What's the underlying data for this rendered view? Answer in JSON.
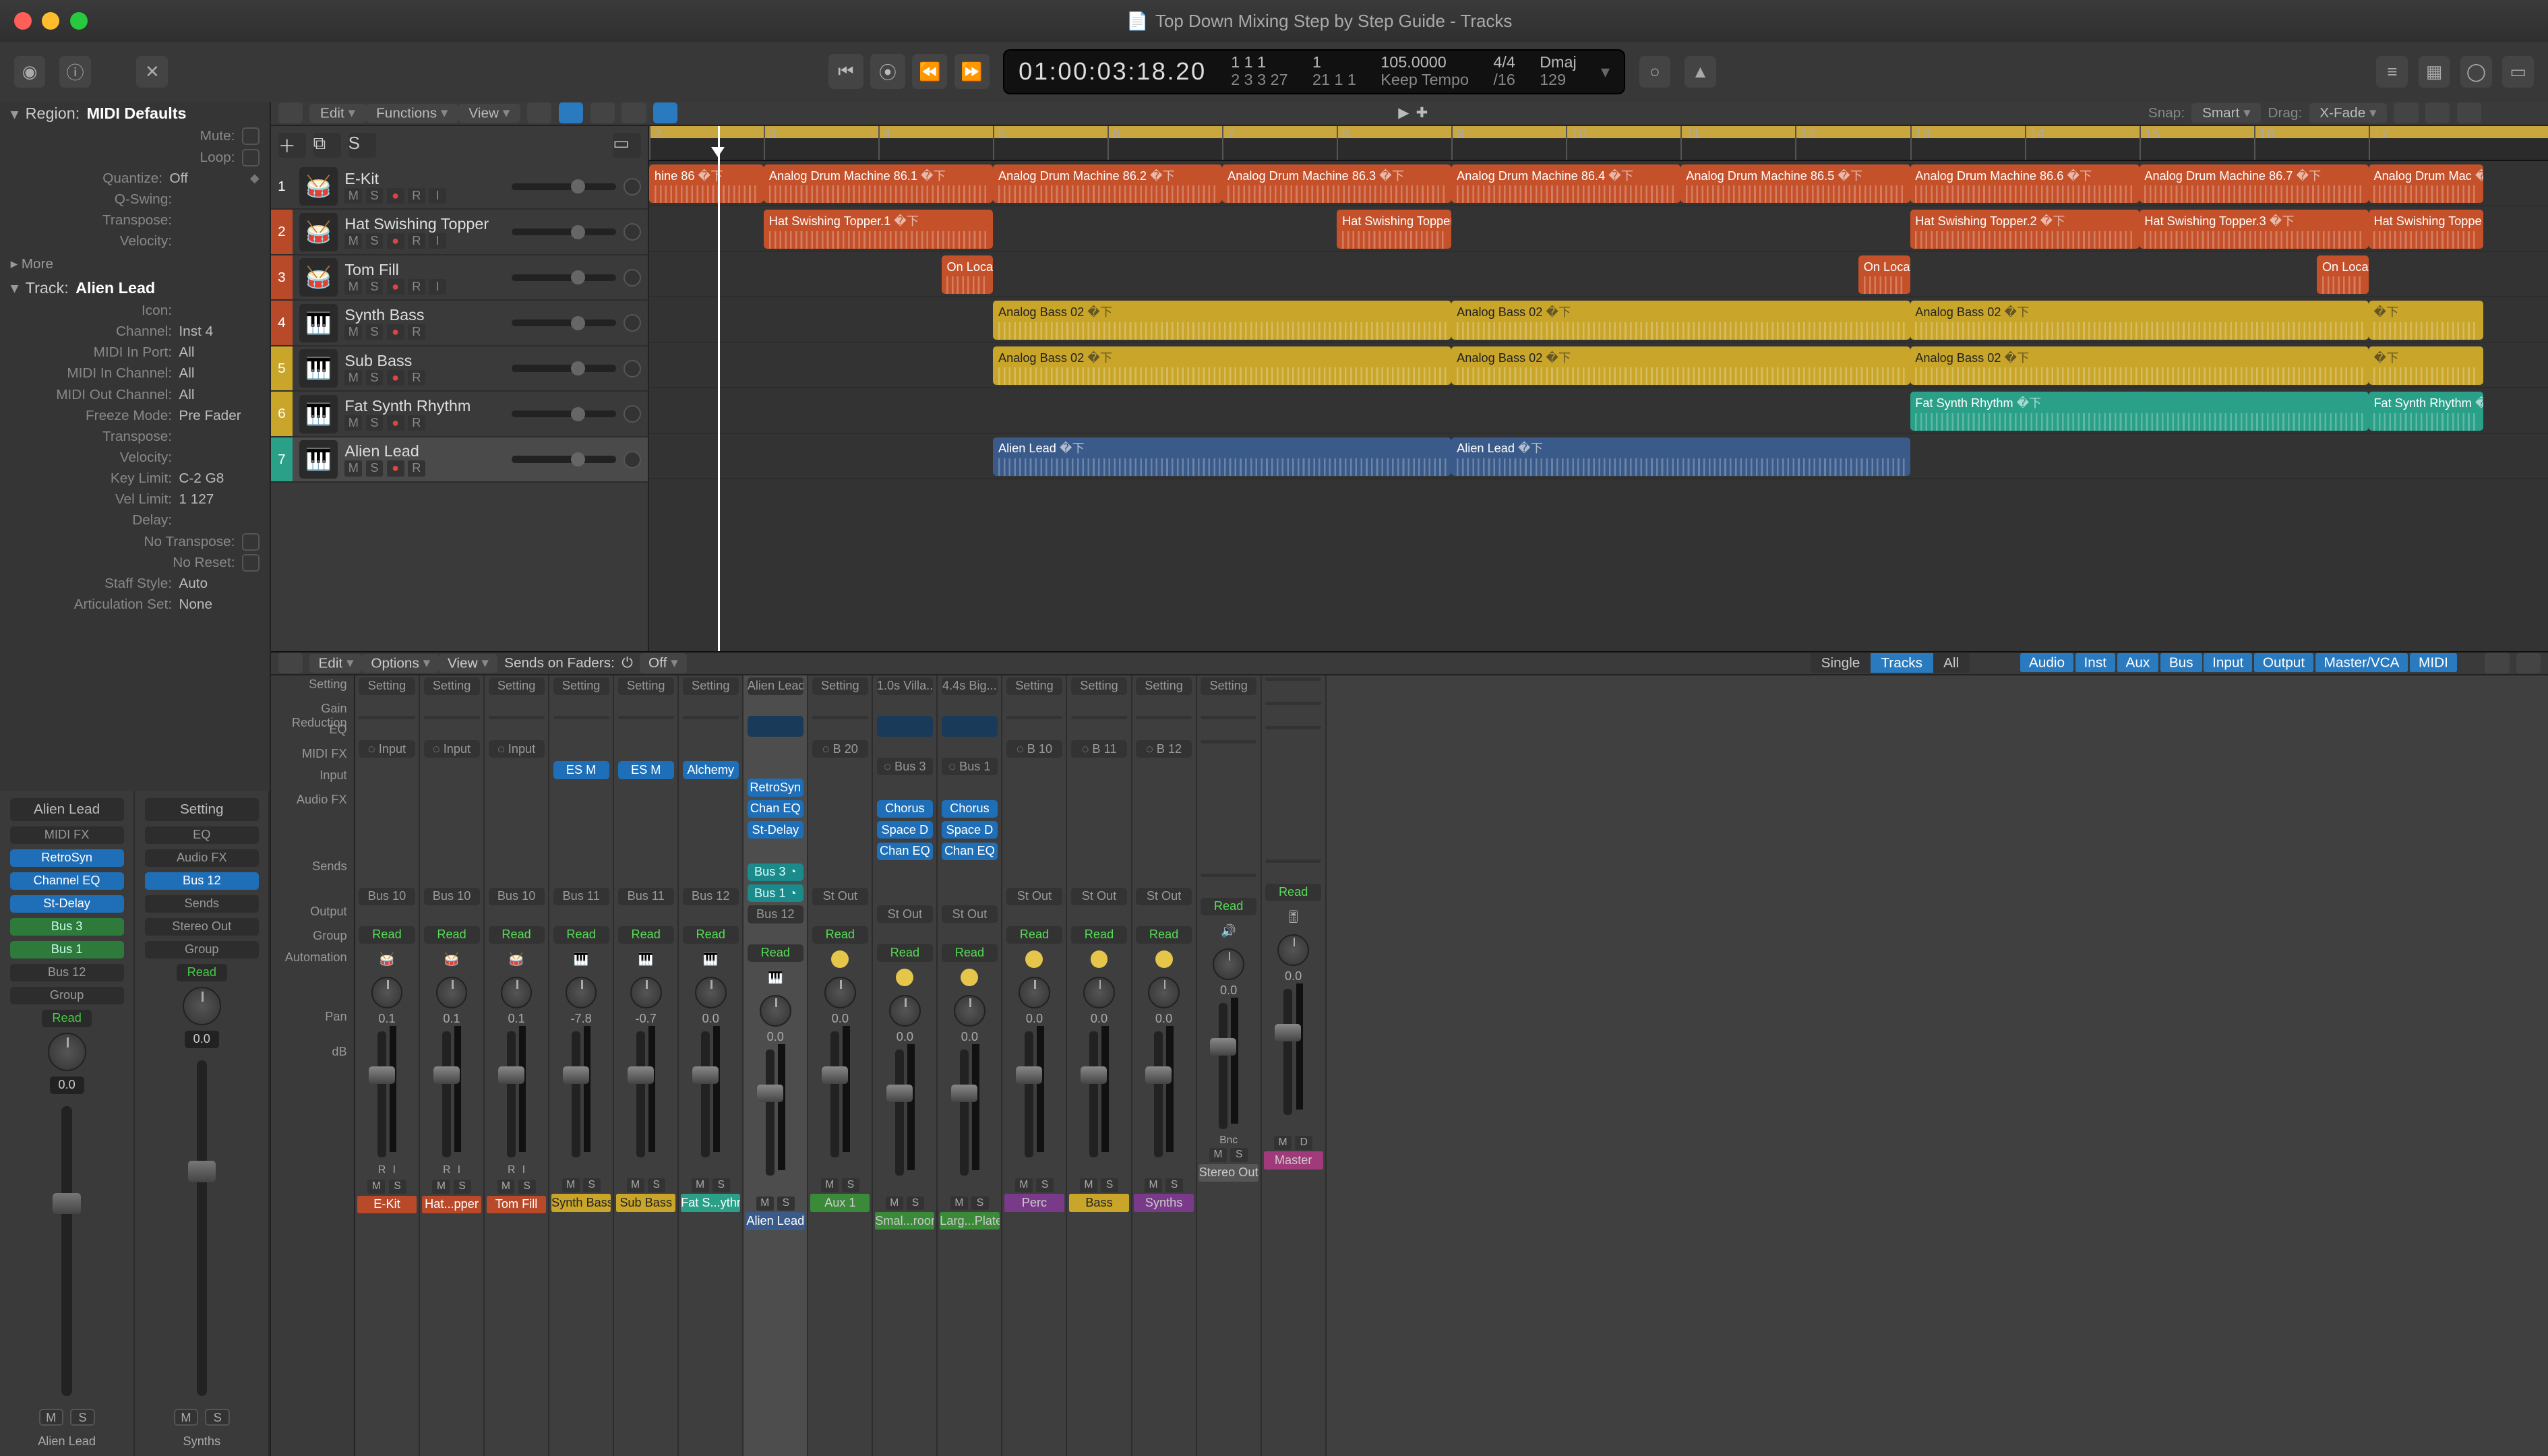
{
  "window": {
    "title": "Top Down Mixing Step by Step Guide - Tracks"
  },
  "lcd": {
    "smpte": "01:00:03:18.20",
    "bars1_top": "1  1  1",
    "bars1_bot": "2  3  3   27",
    "bars2_top": "1",
    "bars2_bot": "21  1  1",
    "tempo_top": "105.0000",
    "tempo_bot": "Keep Tempo",
    "sig_top": "4/4",
    "sig_bot": "/16",
    "key_top": "Dmaj",
    "key_bot": "129"
  },
  "region_inspector": {
    "header_label": "Region:",
    "header_value": "MIDI Defaults",
    "rows": [
      {
        "label": "Mute:",
        "type": "check"
      },
      {
        "label": "Loop:",
        "type": "check"
      },
      {
        "label": "Quantize:",
        "value": "Off",
        "caret": true
      },
      {
        "label": "Q-Swing:",
        "value": ""
      },
      {
        "label": "Transpose:",
        "value": ""
      },
      {
        "label": "Velocity:",
        "value": ""
      }
    ],
    "more_label": "More"
  },
  "track_inspector": {
    "header_label": "Track:",
    "header_value": "Alien Lead",
    "rows": [
      {
        "label": "Icon:",
        "value": ""
      },
      {
        "label": "Channel:",
        "value": "Inst 4"
      },
      {
        "label": "MIDI In Port:",
        "value": "All"
      },
      {
        "label": "MIDI In Channel:",
        "value": "All"
      },
      {
        "label": "MIDI Out Channel:",
        "value": "All"
      },
      {
        "label": "Freeze Mode:",
        "value": "Pre Fader"
      },
      {
        "label": "Transpose:",
        "value": ""
      },
      {
        "label": "Velocity:",
        "value": ""
      },
      {
        "label": "Key Limit:",
        "value": "C-2  G8"
      },
      {
        "label": "Vel Limit:",
        "value": "1  127"
      },
      {
        "label": "Delay:",
        "value": ""
      },
      {
        "label": "No Transpose:",
        "type": "check"
      },
      {
        "label": "No Reset:",
        "type": "check"
      },
      {
        "label": "Staff Style:",
        "value": "Auto"
      },
      {
        "label": "Articulation Set:",
        "value": "None"
      }
    ]
  },
  "left_strips": [
    {
      "name": "Alien Lead",
      "slots": [
        "MIDI FX",
        "RetroSyn",
        "Channel EQ",
        "St-Delay",
        "Bus 3",
        "Bus 1",
        "Bus 12"
      ],
      "slot_classes": [
        "",
        "blue",
        "blue",
        "blue",
        "green",
        "green",
        ""
      ],
      "setting": "Setting",
      "group": "Group",
      "read": "Read",
      "db": "0.0",
      "footer": "Alien Lead"
    },
    {
      "name": "Setting",
      "slots": [
        "EQ",
        "Audio FX",
        "Bus 12",
        "Sends",
        "Stereo Out"
      ],
      "slot_classes": [
        "",
        "",
        "blue",
        "",
        ""
      ],
      "setting": "",
      "group": "Group",
      "read": "Read",
      "db": "0.0",
      "footer": "Synths"
    }
  ],
  "trk_toolbar": {
    "menus": [
      "Edit",
      "Functions",
      "View"
    ],
    "right": {
      "snap_label": "Snap:",
      "snap_val": "Smart",
      "drag_label": "Drag:",
      "drag_val": "X-Fade"
    }
  },
  "tracks": [
    {
      "n": 1,
      "name": "E-Kit",
      "icon": "🥁",
      "rec": true
    },
    {
      "n": 2,
      "name": "Hat Swishing Topper",
      "icon": "🥁",
      "rec": true
    },
    {
      "n": 3,
      "name": "Tom Fill",
      "icon": "🥁",
      "rec": true
    },
    {
      "n": 4,
      "name": "Synth Bass",
      "icon": "🎹",
      "rec": true
    },
    {
      "n": 5,
      "name": "Sub Bass",
      "icon": "🎹",
      "rec": true
    },
    {
      "n": 6,
      "name": "Fat Synth Rhythm",
      "icon": "🎹",
      "rec": true
    },
    {
      "n": 7,
      "name": "Alien Lead",
      "icon": "🎹",
      "rec": true,
      "selected": true
    }
  ],
  "ruler_bars": [
    2,
    3,
    4,
    5,
    6,
    7,
    8,
    9,
    10,
    11,
    12,
    13,
    14,
    15,
    16,
    17
  ],
  "playhead_bar": 2.6,
  "regions": {
    "1": [
      {
        "name": "hine 86",
        "start": 2,
        "end": 3,
        "cls": "reg-dr"
      },
      {
        "name": "Analog Drum Machine 86.1",
        "start": 3,
        "end": 5,
        "cls": "reg-dr"
      },
      {
        "name": "Analog Drum Machine 86.2",
        "start": 5,
        "end": 7,
        "cls": "reg-dr"
      },
      {
        "name": "Analog Drum Machine 86.3",
        "start": 7,
        "end": 9,
        "cls": "reg-dr"
      },
      {
        "name": "Analog Drum Machine 86.4",
        "start": 9,
        "end": 11,
        "cls": "reg-dr"
      },
      {
        "name": "Analog Drum Machine 86.5",
        "start": 11,
        "end": 13,
        "cls": "reg-dr"
      },
      {
        "name": "Analog Drum Machine 86.6",
        "start": 13,
        "end": 15,
        "cls": "reg-dr"
      },
      {
        "name": "Analog Drum Machine 86.7",
        "start": 15,
        "end": 17,
        "cls": "reg-dr"
      },
      {
        "name": "Analog Drum Mac",
        "start": 17,
        "end": 18,
        "cls": "reg-dr"
      }
    ],
    "2": [
      {
        "name": "Hat Swishing Topper.1",
        "start": 3,
        "end": 5,
        "cls": "reg-dr"
      },
      {
        "name": "Hat Swishing Topper",
        "start": 8,
        "end": 9,
        "cls": "reg-dr"
      },
      {
        "name": "Hat Swishing Topper.2",
        "start": 13,
        "end": 15,
        "cls": "reg-dr"
      },
      {
        "name": "Hat Swishing Topper.3",
        "start": 15,
        "end": 17,
        "cls": "reg-dr"
      },
      {
        "name": "Hat Swishing Toppe",
        "start": 17,
        "end": 18,
        "cls": "reg-dr"
      }
    ],
    "3": [
      {
        "name": "On Locati",
        "start": 4.55,
        "end": 5,
        "cls": "reg-dr"
      },
      {
        "name": "On Location To",
        "start": 12.55,
        "end": 13,
        "cls": "reg-dr"
      },
      {
        "name": "On Location To",
        "start": 16.55,
        "end": 17,
        "cls": "reg-dr"
      }
    ],
    "4": [
      {
        "name": "Analog Bass 02",
        "start": 5,
        "end": 9,
        "cls": "reg-ye"
      },
      {
        "name": "Analog Bass 02",
        "start": 9,
        "end": 13,
        "cls": "reg-ye"
      },
      {
        "name": "Analog Bass 02",
        "start": 13,
        "end": 17,
        "cls": "reg-ye"
      },
      {
        "name": "",
        "start": 17,
        "end": 18,
        "cls": "reg-ye"
      }
    ],
    "5": [
      {
        "name": "Analog Bass 02",
        "start": 5,
        "end": 9,
        "cls": "reg-ye"
      },
      {
        "name": "Analog Bass 02",
        "start": 9,
        "end": 13,
        "cls": "reg-ye"
      },
      {
        "name": "Analog Bass 02",
        "start": 13,
        "end": 17,
        "cls": "reg-ye"
      },
      {
        "name": "",
        "start": 17,
        "end": 18,
        "cls": "reg-ye"
      }
    ],
    "6": [
      {
        "name": "Fat Synth Rhythm",
        "start": 13,
        "end": 17,
        "cls": "reg-te"
      },
      {
        "name": "Fat Synth Rhythm",
        "start": 17,
        "end": 18,
        "cls": "reg-te"
      }
    ],
    "7": [
      {
        "name": "Alien Lead",
        "start": 5,
        "end": 9,
        "cls": "reg-bl"
      },
      {
        "name": "Alien Lead",
        "start": 9,
        "end": 13,
        "cls": "reg-bl"
      }
    ]
  },
  "mix_toolbar": {
    "menus": [
      "Edit",
      "Options",
      "View"
    ],
    "sends_label": "Sends on Faders:",
    "sends_val": "Off",
    "seg": [
      "Single",
      "Tracks",
      "All"
    ],
    "seg_active": 1,
    "cats": [
      "Audio",
      "Inst",
      "Aux",
      "Bus",
      "Input",
      "Output",
      "Master/VCA",
      "MIDI"
    ]
  },
  "row_labels": [
    "Setting",
    "Gain Reduction",
    "EQ",
    "MIDI FX",
    "Input",
    "Audio FX",
    "",
    "",
    "Sends",
    "",
    "Output",
    "Group",
    "Automation",
    "",
    "Pan",
    "dB",
    "",
    "",
    "",
    "",
    ""
  ],
  "strips": [
    {
      "name": "E-Kit",
      "cls": "cn-red",
      "setting": "Setting",
      "input": "Input",
      "inst": "",
      "fx": [],
      "sends": [],
      "out": "Bus 10",
      "read": "Read",
      "pan": "0.1",
      "ico": "🥁",
      "ri": true
    },
    {
      "name": "Hat...pper",
      "cls": "cn-red",
      "setting": "Setting",
      "input": "Input",
      "inst": "",
      "fx": [],
      "sends": [],
      "out": "Bus 10",
      "read": "Read",
      "pan": "0.1",
      "ico": "🥁",
      "ri": true
    },
    {
      "name": "Tom Fill",
      "cls": "cn-red",
      "setting": "Setting",
      "input": "Input",
      "inst": "",
      "fx": [],
      "sends": [],
      "out": "Bus 10",
      "read": "Read",
      "pan": "0.1",
      "ico": "🥁",
      "ri": true
    },
    {
      "name": "Synth Bass",
      "cls": "cn-yel",
      "setting": "Setting",
      "inst": "ES M",
      "inst_cls": "blue",
      "fx": [],
      "sends": [],
      "out": "Bus 11",
      "read": "Read",
      "pan": "-7.8",
      "ico": "🎹"
    },
    {
      "name": "Sub Bass",
      "cls": "cn-yel",
      "setting": "Setting",
      "inst": "ES M",
      "inst_cls": "blue",
      "fx": [],
      "sends": [],
      "out": "Bus 11",
      "read": "Read",
      "pan": "-0.7",
      "ico": "🎹"
    },
    {
      "name": "Fat S...ythm",
      "cls": "cn-teal",
      "setting": "Setting",
      "inst": "Alchemy",
      "inst_cls": "blue",
      "fx": [],
      "sends": [],
      "out": "Bus 12",
      "read": "Read",
      "pan": "0.0",
      "ico": "🎹"
    },
    {
      "name": "Alien Lead",
      "cls": "cn-blue",
      "sel": true,
      "setting": "Alien Lead",
      "eq": true,
      "inst": "RetroSyn",
      "inst_cls": "blue",
      "fx": [
        "Chan EQ",
        "St-Delay"
      ],
      "fx_cls": [
        "blue",
        "blue"
      ],
      "sends": [
        "Bus 3",
        "Bus 1"
      ],
      "sends_cls": [
        "teal",
        "teal"
      ],
      "out": "Bus 12",
      "read": "Read",
      "pan": "0.0",
      "ico": "🎹"
    },
    {
      "name": "Aux 1",
      "cls": "cn-grn",
      "setting": "Setting",
      "input": "B 20",
      "inst": "",
      "fx": [],
      "sends": [],
      "out": "St Out",
      "read": "Read",
      "pan": "0.0",
      "ico": "🟡"
    },
    {
      "name": "Smal...room",
      "cls": "cn-grn",
      "setting": "1.0s Villa...",
      "eq": true,
      "input": "Bus 3",
      "inst": "",
      "fx": [
        "Chorus",
        "Space D",
        "Chan EQ"
      ],
      "fx_cls": [
        "blue",
        "blue",
        "blue"
      ],
      "sends": [],
      "out": "St Out",
      "read": "Read",
      "pan": "0.0",
      "ico": "🟡"
    },
    {
      "name": "Larg...Plate",
      "cls": "cn-grn",
      "setting": "4.4s Big...",
      "eq": true,
      "input": "Bus 1",
      "inst": "",
      "fx": [
        "Chorus",
        "Space D",
        "Chan EQ"
      ],
      "fx_cls": [
        "blue",
        "blue",
        "blue"
      ],
      "sends": [],
      "out": "St Out",
      "read": "Read",
      "pan": "0.0",
      "ico": "🟡"
    },
    {
      "name": "Perc",
      "cls": "cn-pur",
      "setting": "Setting",
      "input": "B 10",
      "inst": "",
      "fx": [],
      "sends": [],
      "out": "St Out",
      "read": "Read",
      "pan": "0.0",
      "ico": "🟡"
    },
    {
      "name": "Bass",
      "cls": "cn-yel",
      "setting": "Setting",
      "input": "B 11",
      "inst": "",
      "fx": [],
      "sends": [],
      "out": "St Out",
      "read": "Read",
      "pan": "0.0",
      "ico": "🟡"
    },
    {
      "name": "Synths",
      "cls": "cn-pur",
      "setting": "Setting",
      "input": "B 12",
      "inst": "",
      "fx": [],
      "sends": [],
      "out": "St Out",
      "read": "Read",
      "pan": "0.0",
      "ico": "🟡"
    },
    {
      "name": "Stereo Out",
      "cls": "cn-gray",
      "setting": "Setting",
      "input": "",
      "inst": "",
      "fx": [],
      "sends": [],
      "out": "",
      "read": "Read",
      "pan": "0.0",
      "ico": "🔊",
      "bnc": "Bnc"
    },
    {
      "name": "Master",
      "cls": "cn-mag",
      "setting": "",
      "input": "",
      "inst": "",
      "fx": [],
      "sends": [],
      "out": "",
      "read": "Read",
      "pan": "0.0",
      "ico": "🎚",
      "md": true
    }
  ],
  "labels": {
    "m": "M",
    "s": "S",
    "r": "R",
    "i": "I",
    "d": "D",
    "read": "Read",
    "more": "More",
    "group": "Group"
  }
}
